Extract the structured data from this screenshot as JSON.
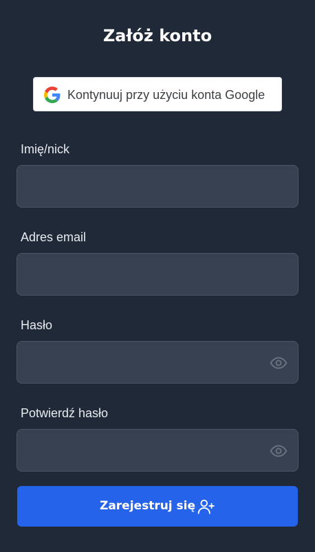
{
  "page": {
    "title": "Załóż konto"
  },
  "google": {
    "label": "Kontynuuj przy użyciu konta Google"
  },
  "fields": {
    "name": {
      "label": "Imię/nick",
      "value": ""
    },
    "email": {
      "label": "Adres email",
      "value": ""
    },
    "password": {
      "label": "Hasło",
      "value": ""
    },
    "confirm": {
      "label": "Potwierdź hasło",
      "value": ""
    }
  },
  "submit": {
    "label": "Zarejestruj się"
  },
  "icons": {
    "google": "google-logo-icon",
    "eye": "eye-icon",
    "user_plus": "user-plus-icon"
  },
  "colors": {
    "background": "#202938",
    "input_bg": "#374151",
    "input_border": "#4b5563",
    "primary": "#2563eb",
    "text": "#ffffff",
    "label": "#e8ebf0",
    "icon_muted": "#6b7280"
  }
}
